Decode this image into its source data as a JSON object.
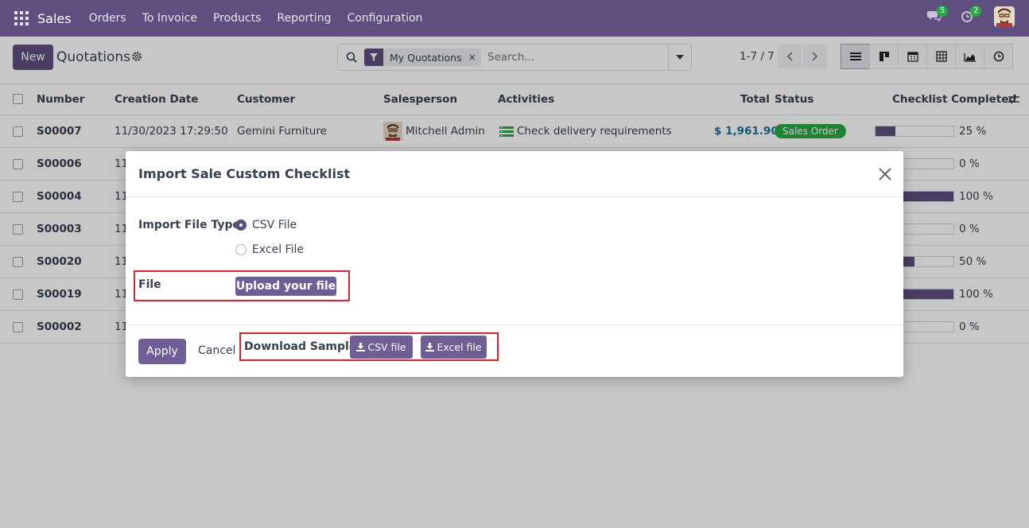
{
  "navbar": {
    "brand": "Sales",
    "menu": [
      "Orders",
      "To Invoice",
      "Products",
      "Reporting",
      "Configuration"
    ],
    "messages_count": "5",
    "activities_count": "2"
  },
  "control": {
    "new_label": "New",
    "title": "Quotations",
    "facet_label": "My Quotations",
    "facet_remove": "×",
    "search_placeholder": "Search...",
    "pager": "1-7 / 7"
  },
  "table": {
    "headers": {
      "number": "Number",
      "creation_date": "Creation Date",
      "customer": "Customer",
      "salesperson": "Salesperson",
      "activities": "Activities",
      "total": "Total",
      "status": "Status",
      "checklist": "Checklist Completed"
    },
    "rows": [
      {
        "number": "S00007",
        "date": "11/30/2023 17:29:50",
        "customer": "Gemini Furniture",
        "salesperson": "Mitchell Admin",
        "activity": "Check delivery requirements",
        "total": "$ 1,961.90",
        "status": "Sales Order",
        "progress": 25,
        "pct": "25 %"
      },
      {
        "number": "S00006",
        "date": "11",
        "progress": 0,
        "pct": "0 %"
      },
      {
        "number": "S00004",
        "date": "11",
        "progress": 100,
        "pct": "100 %"
      },
      {
        "number": "S00003",
        "date": "11",
        "progress": 0,
        "pct": "0 %"
      },
      {
        "number": "S00020",
        "date": "11",
        "progress": 50,
        "pct": "50 %"
      },
      {
        "number": "S00019",
        "date": "11",
        "progress": 100,
        "pct": "100 %"
      },
      {
        "number": "S00002",
        "date": "11",
        "progress": 0,
        "pct": "0 %"
      }
    ]
  },
  "modal": {
    "title": "Import Sale Custom Checklist",
    "import_type_label": "Import File Type",
    "options": [
      "CSV File",
      "Excel File"
    ],
    "selected_option": "CSV File",
    "file_label": "File",
    "upload_label": "Upload your file",
    "apply_label": "Apply",
    "cancel_label": "Cancel",
    "download_label": "Download Sample:",
    "csv_btn": "CSV file",
    "excel_btn": "Excel file"
  },
  "colors": {
    "brand": "#5f4f7f",
    "highlight": "#d0262e",
    "status_green": "#28a745"
  }
}
